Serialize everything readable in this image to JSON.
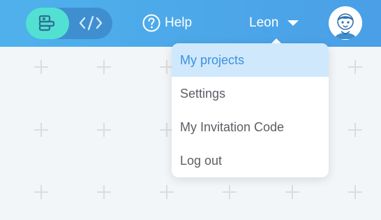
{
  "header": {
    "help_label": "Help",
    "user_name": "Leon",
    "mode_toggle": {
      "active": "block-editor",
      "options": [
        "block-editor-icon",
        "code-icon"
      ]
    },
    "colors": {
      "header_start": "#4fb1ec",
      "header_end": "#4a9fe6",
      "toggle_active": "#52e0d2"
    }
  },
  "dropdown": {
    "items": [
      {
        "label": "My projects",
        "active": true
      },
      {
        "label": "Settings",
        "active": false
      },
      {
        "label": "My Invitation Code",
        "active": false
      },
      {
        "label": "Log out",
        "active": false
      }
    ],
    "colors": {
      "active_bg": "#cfe8fc",
      "active_text": "#3b91e0",
      "text": "#5a5e64"
    }
  },
  "background": {
    "pattern": "plus-grid"
  }
}
